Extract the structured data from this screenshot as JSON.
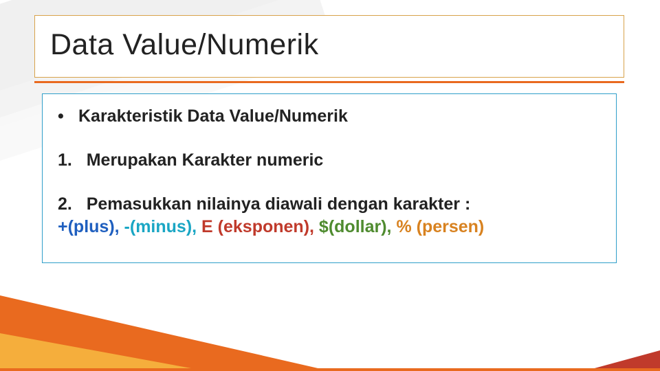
{
  "title": "Data Value/Numerik",
  "bullet": {
    "marker": "•",
    "text": "Karakteristik Data Value/Numerik"
  },
  "item1": {
    "num": "1.",
    "text": "Merupakan Karakter numeric"
  },
  "item2": {
    "num": "2.",
    "lead": "Pemasukkan nilainya diawali dengan karakter :",
    "parts": {
      "plus": "+(plus),",
      "minus": "-(minus),",
      "exp": "E (eksponen),",
      "dollar": "$(dollar),",
      "pct": "% (persen)"
    }
  }
}
